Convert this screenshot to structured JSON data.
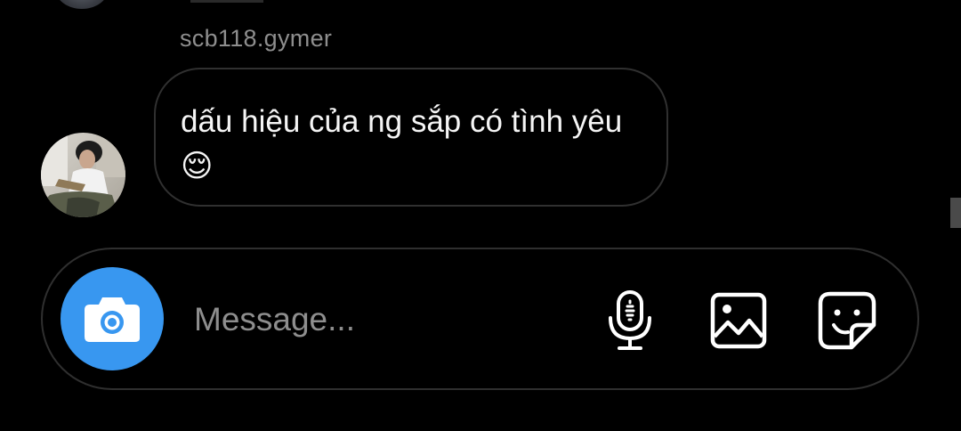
{
  "conversation": {
    "message": {
      "sender": "scb118.gymer",
      "text": "dấu hiệu của ng sắp có tình yêu😌"
    }
  },
  "composer": {
    "placeholder": "Message...",
    "camera_icon": "camera-icon",
    "mic_icon": "microphone-icon",
    "gallery_icon": "image-gallery-icon",
    "sticker_icon": "sticker-icon"
  },
  "colors": {
    "background": "#000000",
    "bubble_border": "#303030",
    "message_text": "#f5f5f5",
    "sender_name": "#8e8e8e",
    "placeholder": "#8e8e8e",
    "camera_accent": "#3897f0"
  }
}
